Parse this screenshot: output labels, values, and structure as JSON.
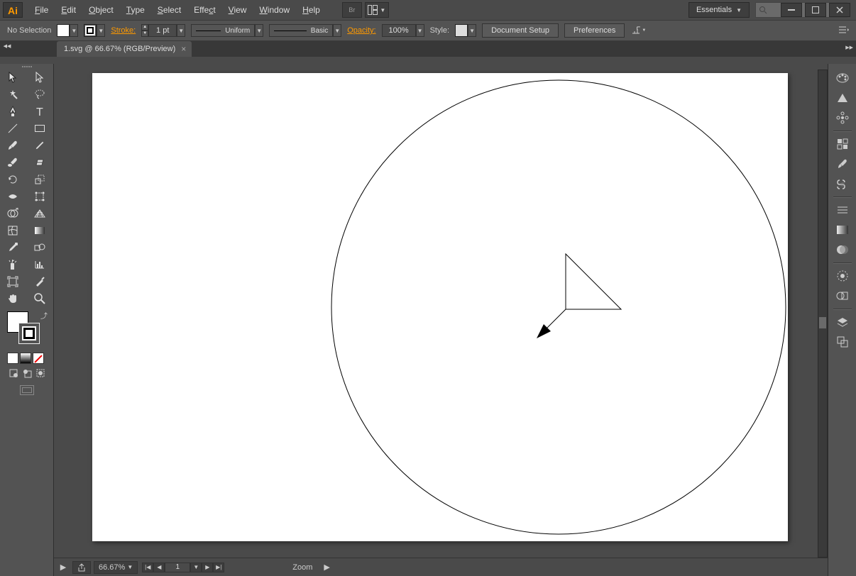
{
  "menus": {
    "file": "File",
    "edit": "Edit",
    "object": "Object",
    "type": "Type",
    "select": "Select",
    "effect": "Effect",
    "view": "View",
    "window": "Window",
    "help": "Help"
  },
  "workspace": {
    "label": "Essentials"
  },
  "control": {
    "selection": "No Selection",
    "stroke_label": "Stroke:",
    "stroke_val": "1 pt",
    "profile": "Uniform",
    "brush": "Basic",
    "opacity_label": "Opacity:",
    "opacity_val": "100%",
    "style_label": "Style:",
    "btn_docsetup": "Document Setup",
    "btn_prefs": "Preferences"
  },
  "tab": {
    "title": "1.svg @ 66.67% (RGB/Preview)"
  },
  "status": {
    "zoom": "66.67%",
    "page": "1",
    "tool": "Zoom"
  }
}
